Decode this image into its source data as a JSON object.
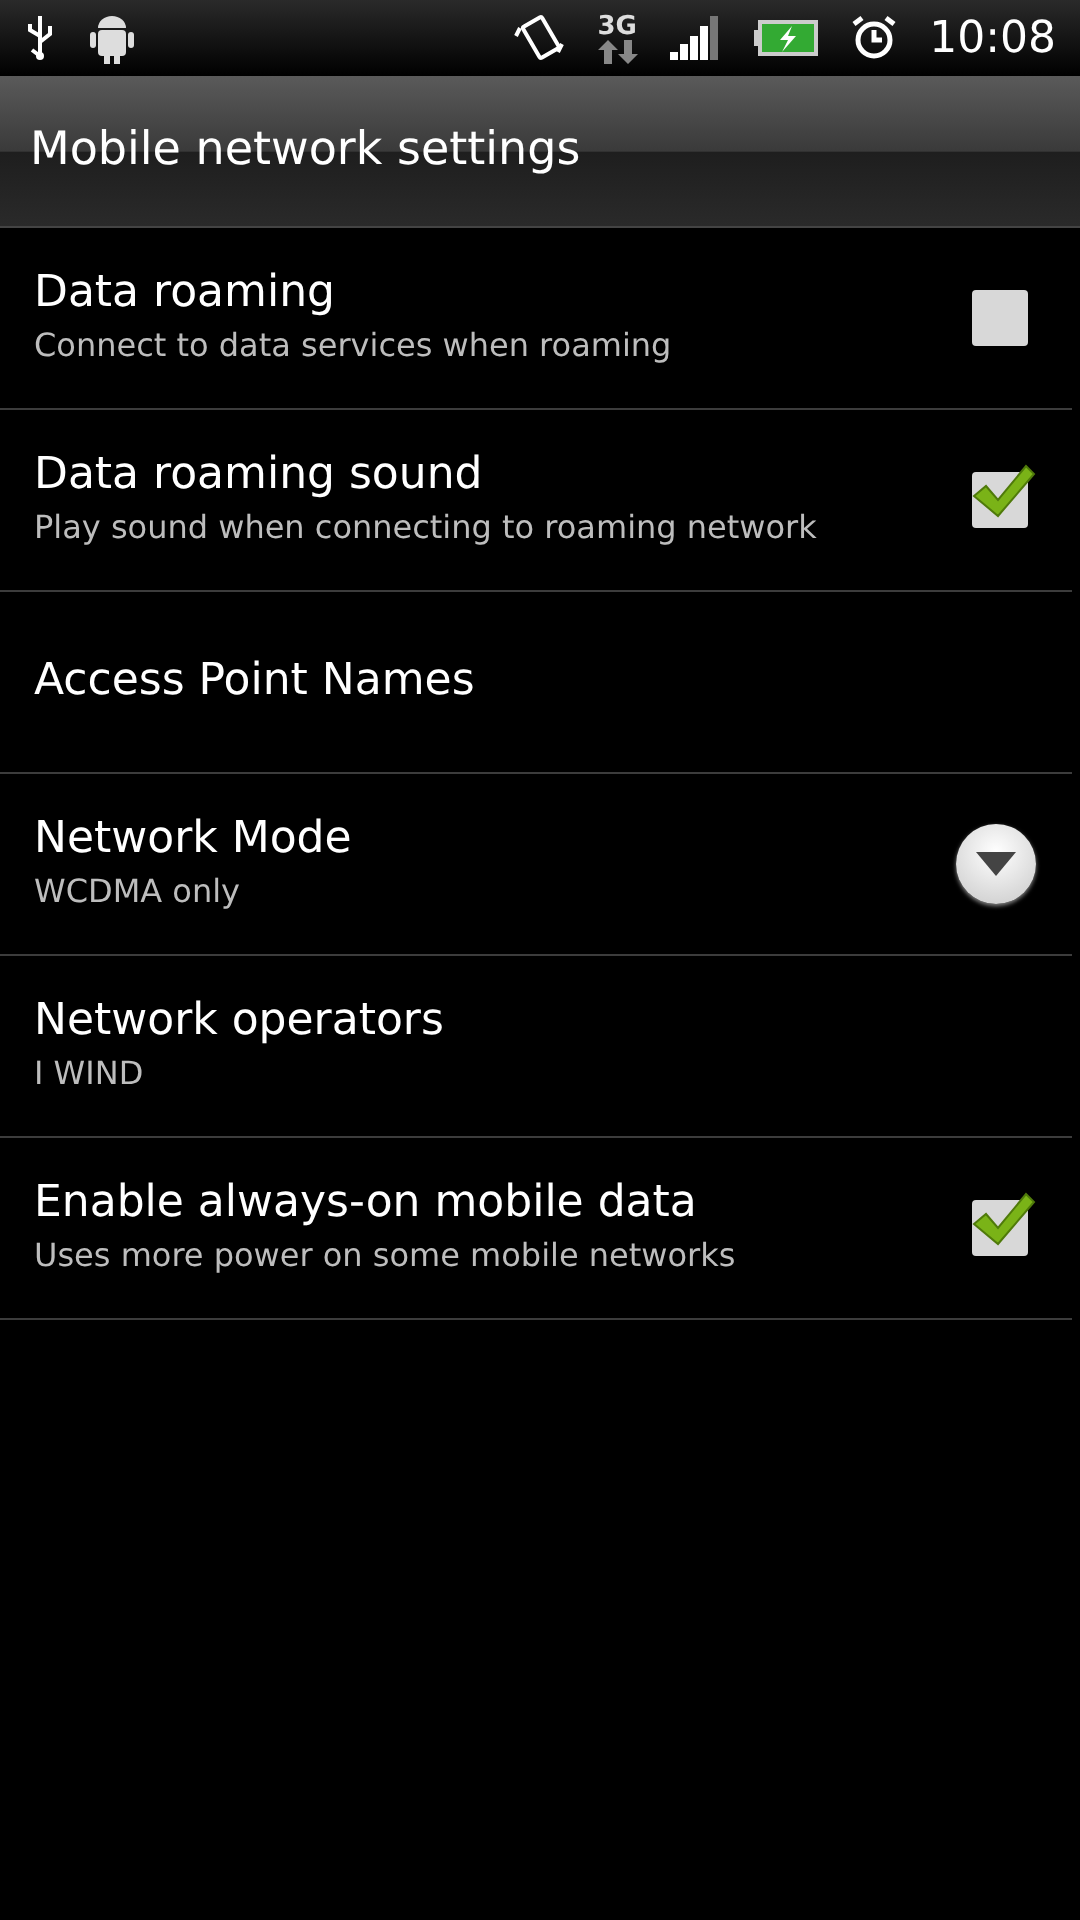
{
  "status_bar": {
    "network_type": "3G",
    "time": "10:08"
  },
  "title": "Mobile network settings",
  "items": [
    {
      "kind": "checkbox",
      "title": "Data roaming",
      "summary": "Connect to data services when roaming",
      "checked": false
    },
    {
      "kind": "checkbox",
      "title": "Data roaming sound",
      "summary": "Play sound when connecting to roaming network",
      "checked": true
    },
    {
      "kind": "plain",
      "title": "Access Point Names"
    },
    {
      "kind": "dropdown",
      "title": "Network Mode",
      "summary": "WCDMA only"
    },
    {
      "kind": "plain",
      "title": "Network operators",
      "summary": "I WIND"
    },
    {
      "kind": "checkbox",
      "title": "Enable always-on mobile data",
      "summary": "Uses more power on some mobile networks",
      "checked": true
    }
  ]
}
